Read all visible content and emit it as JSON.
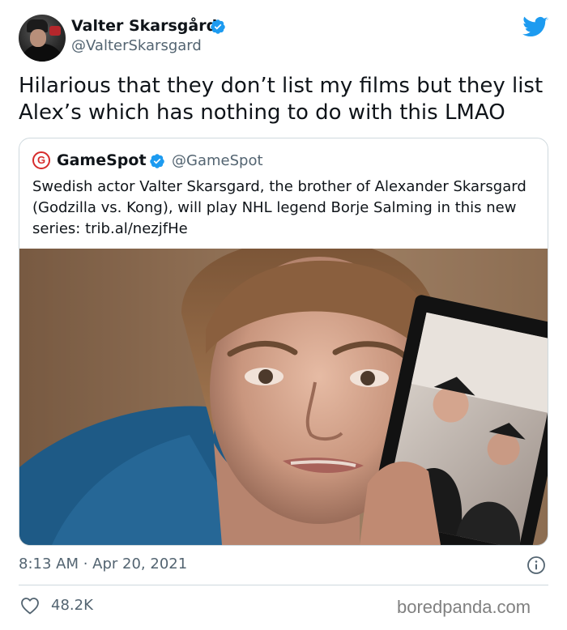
{
  "author": {
    "display_name": "Valter Skarsgård",
    "handle": "@ValterSkarsgard",
    "verified": true
  },
  "tweet": {
    "text": "Hilarious that they don’t list my films but they list Alex’s which has nothing to do with this LMAO",
    "timestamp": "8:13 AM · Apr 20, 2021",
    "likes": "48.2K"
  },
  "quoted_tweet": {
    "logo_letter": "G",
    "display_name": "GameSpot",
    "handle": "@GameSpot",
    "verified": true,
    "text": "Swedish actor Valter Skarsgard, the brother of Alexander Skarsgard (Godzilla vs. Kong), will play NHL legend Borje Salming in this new series: trib.al/nezjfHe"
  },
  "icons": {
    "verified": "verified-badge-icon",
    "brand": "twitter-bird-icon",
    "info": "info-icon",
    "like": "heart-icon"
  },
  "colors": {
    "verified": "#1d9bf0",
    "twitter": "#1d9bf0",
    "secondary_text": "#536471",
    "gamespot": "#d62b2b"
  },
  "watermark": "boredpanda.com"
}
